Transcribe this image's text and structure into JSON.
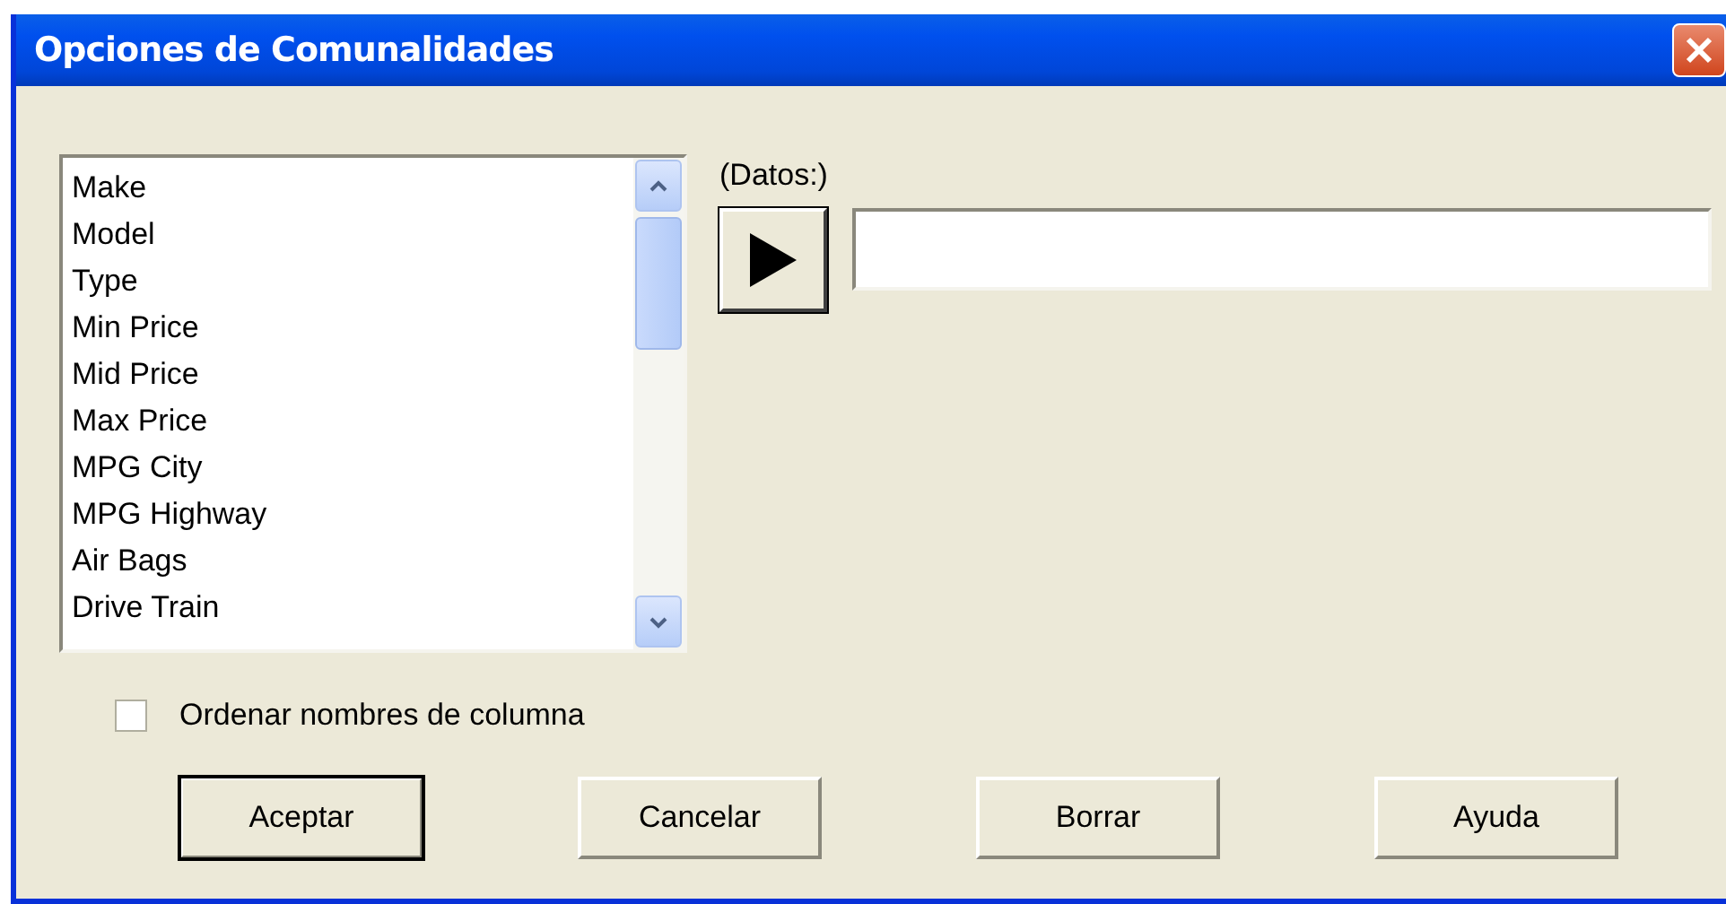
{
  "window": {
    "title": "Opciones de Comunalidades"
  },
  "columns_list": {
    "items": [
      {
        "label": "Make",
        "selected": false
      },
      {
        "label": "Model",
        "selected": false
      },
      {
        "label": "Type",
        "selected": false
      },
      {
        "label": "Min Price",
        "selected": false
      },
      {
        "label": "Mid Price",
        "selected": false
      },
      {
        "label": "Max Price",
        "selected": false
      },
      {
        "label": "MPG City",
        "selected": false
      },
      {
        "label": "MPG Highway",
        "selected": false
      },
      {
        "label": "Air Bags",
        "selected": false
      },
      {
        "label": "Drive Train",
        "selected": false
      }
    ]
  },
  "data_field": {
    "label": "(Datos:)"
  },
  "sort_checkbox": {
    "label": "Ordenar nombres de columna",
    "checked": false
  },
  "buttons": [
    {
      "label": "Aceptar",
      "default": true
    },
    {
      "label": "Cancelar",
      "default": false
    },
    {
      "label": "Borrar",
      "default": false
    },
    {
      "label": "Ayuda",
      "default": false
    }
  ]
}
